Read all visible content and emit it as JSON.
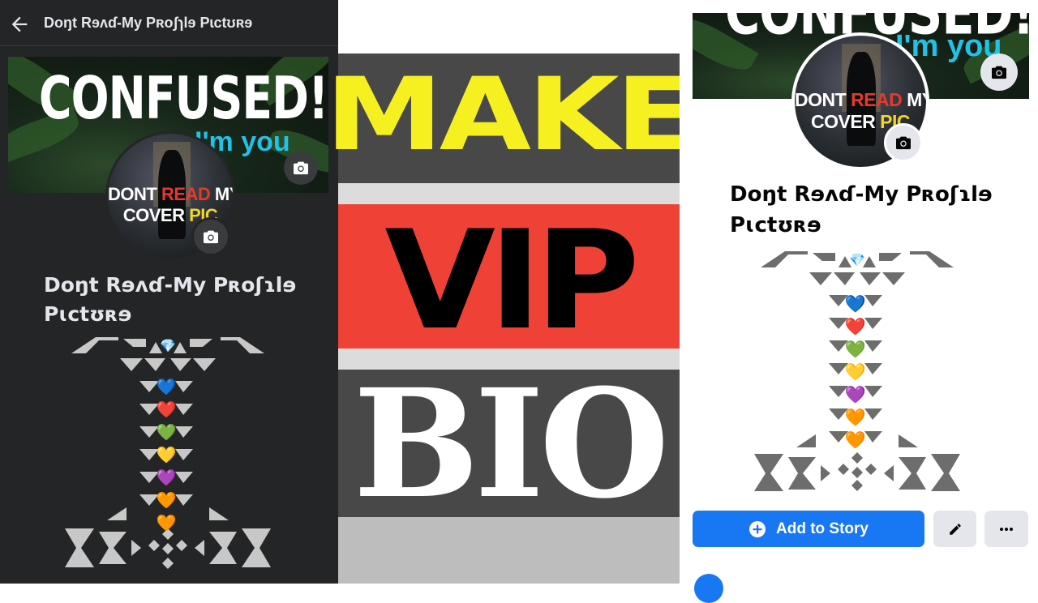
{
  "left_panel": {
    "header_title": "Doŋt Rɘʌɗ-My Pʀoʃɿlɘ Pɩctʊʀɘ",
    "back_icon": "arrow-left-icon",
    "cover": {
      "headline": "CONFUSED!!",
      "subline": "I'm you"
    },
    "avatar": {
      "line1": [
        "DONT ",
        "READ",
        " MY"
      ],
      "line2": [
        "COVER ",
        "PIC"
      ]
    },
    "profile_name_line1": "Doŋt Rɘʌɗ-My Pʀoʃɿlɘ",
    "profile_name_line2": "Pɩctʊʀɘ",
    "camera_icon": "camera-icon"
  },
  "middle_panel": {
    "word1": "MAKE",
    "word2": "VIP",
    "word3": "BIO",
    "colors": {
      "make": "#f7f020",
      "vip_band": "#ef4136",
      "dark_band": "#484848",
      "light_band": "#dcdcdc"
    }
  },
  "right_panel": {
    "cover": {
      "headline": "CONFUSED!!",
      "subline": "I'm you"
    },
    "avatar": {
      "line1": [
        "DONT ",
        "READ",
        " MY"
      ],
      "line2": [
        "COVER ",
        "PIC"
      ]
    },
    "profile_name_line1": "Doŋt Rɘʌɗ-My Pʀoʃɿlɘ",
    "profile_name_line2": "Pɩctʊʀɘ",
    "add_story_label": "Add to Story",
    "add_story_icon": "plus-circle-icon",
    "edit_icon": "pencil-icon",
    "more_icon": "more-horizontal-icon",
    "accent": "#1877f2"
  },
  "bio_decoration": {
    "gem": "💎",
    "hearts": [
      "💙",
      "❤️",
      "💚",
      "💛",
      "💜",
      "🧡",
      "🧡"
    ]
  }
}
